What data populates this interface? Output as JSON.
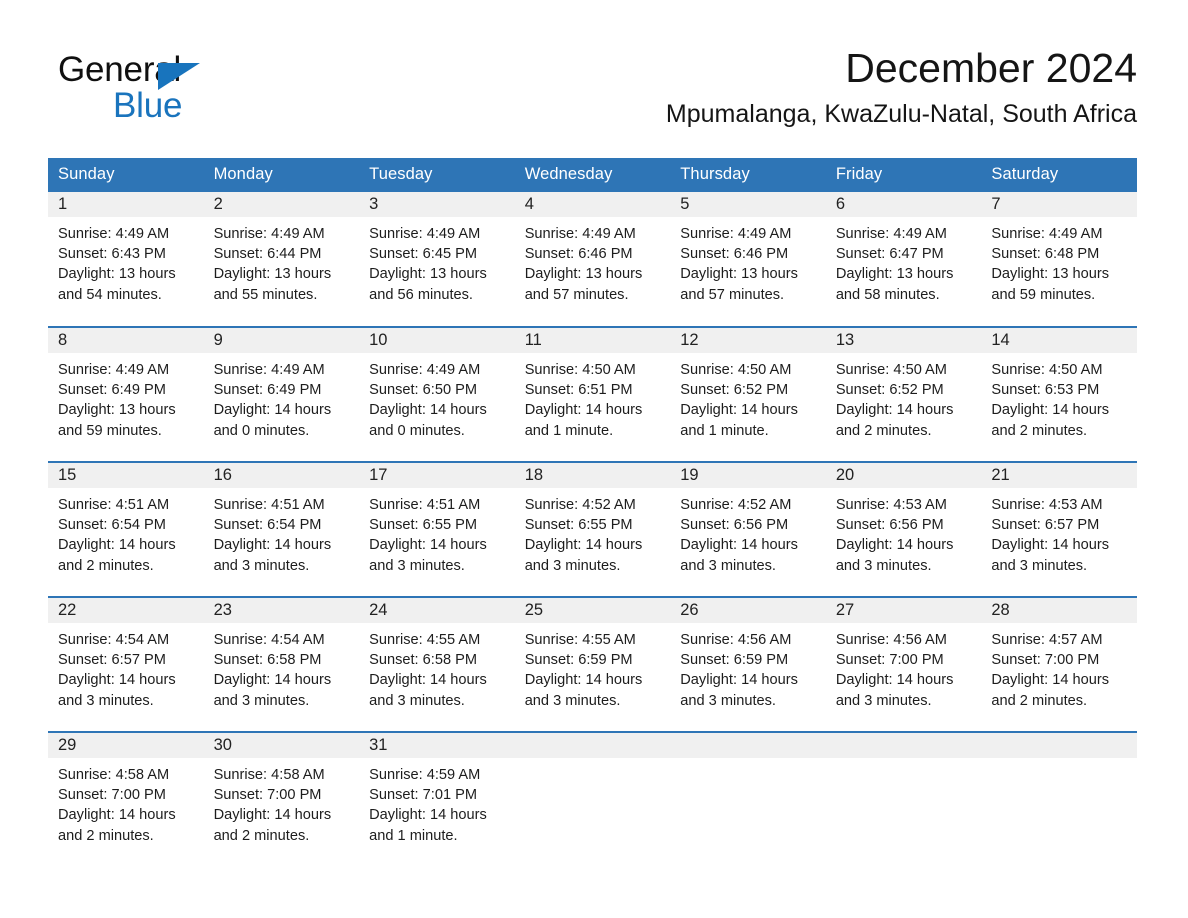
{
  "brand": {
    "name_part1": "General",
    "name_part2": "Blue",
    "accent_color": "#1a74bd"
  },
  "header": {
    "title": "December 2024",
    "subtitle": "Mpumalanga, KwaZulu-Natal, South Africa"
  },
  "theme": {
    "header_blue": "#2e75b6",
    "daynum_band": "#f0f0f0",
    "text": "#1d1d1d"
  },
  "weekday_headers": [
    "Sunday",
    "Monday",
    "Tuesday",
    "Wednesday",
    "Thursday",
    "Friday",
    "Saturday"
  ],
  "labels": {
    "sunrise_prefix": "Sunrise:",
    "sunset_prefix": "Sunset:",
    "daylight_prefix": "Daylight:"
  },
  "weeks": [
    [
      {
        "day": "1",
        "sunrise": "Sunrise: 4:49 AM",
        "sunset": "Sunset: 6:43 PM",
        "daylight": "Daylight: 13 hours and 54 minutes."
      },
      {
        "day": "2",
        "sunrise": "Sunrise: 4:49 AM",
        "sunset": "Sunset: 6:44 PM",
        "daylight": "Daylight: 13 hours and 55 minutes."
      },
      {
        "day": "3",
        "sunrise": "Sunrise: 4:49 AM",
        "sunset": "Sunset: 6:45 PM",
        "daylight": "Daylight: 13 hours and 56 minutes."
      },
      {
        "day": "4",
        "sunrise": "Sunrise: 4:49 AM",
        "sunset": "Sunset: 6:46 PM",
        "daylight": "Daylight: 13 hours and 57 minutes."
      },
      {
        "day": "5",
        "sunrise": "Sunrise: 4:49 AM",
        "sunset": "Sunset: 6:46 PM",
        "daylight": "Daylight: 13 hours and 57 minutes."
      },
      {
        "day": "6",
        "sunrise": "Sunrise: 4:49 AM",
        "sunset": "Sunset: 6:47 PM",
        "daylight": "Daylight: 13 hours and 58 minutes."
      },
      {
        "day": "7",
        "sunrise": "Sunrise: 4:49 AM",
        "sunset": "Sunset: 6:48 PM",
        "daylight": "Daylight: 13 hours and 59 minutes."
      }
    ],
    [
      {
        "day": "8",
        "sunrise": "Sunrise: 4:49 AM",
        "sunset": "Sunset: 6:49 PM",
        "daylight": "Daylight: 13 hours and 59 minutes."
      },
      {
        "day": "9",
        "sunrise": "Sunrise: 4:49 AM",
        "sunset": "Sunset: 6:49 PM",
        "daylight": "Daylight: 14 hours and 0 minutes."
      },
      {
        "day": "10",
        "sunrise": "Sunrise: 4:49 AM",
        "sunset": "Sunset: 6:50 PM",
        "daylight": "Daylight: 14 hours and 0 minutes."
      },
      {
        "day": "11",
        "sunrise": "Sunrise: 4:50 AM",
        "sunset": "Sunset: 6:51 PM",
        "daylight": "Daylight: 14 hours and 1 minute."
      },
      {
        "day": "12",
        "sunrise": "Sunrise: 4:50 AM",
        "sunset": "Sunset: 6:52 PM",
        "daylight": "Daylight: 14 hours and 1 minute."
      },
      {
        "day": "13",
        "sunrise": "Sunrise: 4:50 AM",
        "sunset": "Sunset: 6:52 PM",
        "daylight": "Daylight: 14 hours and 2 minutes."
      },
      {
        "day": "14",
        "sunrise": "Sunrise: 4:50 AM",
        "sunset": "Sunset: 6:53 PM",
        "daylight": "Daylight: 14 hours and 2 minutes."
      }
    ],
    [
      {
        "day": "15",
        "sunrise": "Sunrise: 4:51 AM",
        "sunset": "Sunset: 6:54 PM",
        "daylight": "Daylight: 14 hours and 2 minutes."
      },
      {
        "day": "16",
        "sunrise": "Sunrise: 4:51 AM",
        "sunset": "Sunset: 6:54 PM",
        "daylight": "Daylight: 14 hours and 3 minutes."
      },
      {
        "day": "17",
        "sunrise": "Sunrise: 4:51 AM",
        "sunset": "Sunset: 6:55 PM",
        "daylight": "Daylight: 14 hours and 3 minutes."
      },
      {
        "day": "18",
        "sunrise": "Sunrise: 4:52 AM",
        "sunset": "Sunset: 6:55 PM",
        "daylight": "Daylight: 14 hours and 3 minutes."
      },
      {
        "day": "19",
        "sunrise": "Sunrise: 4:52 AM",
        "sunset": "Sunset: 6:56 PM",
        "daylight": "Daylight: 14 hours and 3 minutes."
      },
      {
        "day": "20",
        "sunrise": "Sunrise: 4:53 AM",
        "sunset": "Sunset: 6:56 PM",
        "daylight": "Daylight: 14 hours and 3 minutes."
      },
      {
        "day": "21",
        "sunrise": "Sunrise: 4:53 AM",
        "sunset": "Sunset: 6:57 PM",
        "daylight": "Daylight: 14 hours and 3 minutes."
      }
    ],
    [
      {
        "day": "22",
        "sunrise": "Sunrise: 4:54 AM",
        "sunset": "Sunset: 6:57 PM",
        "daylight": "Daylight: 14 hours and 3 minutes."
      },
      {
        "day": "23",
        "sunrise": "Sunrise: 4:54 AM",
        "sunset": "Sunset: 6:58 PM",
        "daylight": "Daylight: 14 hours and 3 minutes."
      },
      {
        "day": "24",
        "sunrise": "Sunrise: 4:55 AM",
        "sunset": "Sunset: 6:58 PM",
        "daylight": "Daylight: 14 hours and 3 minutes."
      },
      {
        "day": "25",
        "sunrise": "Sunrise: 4:55 AM",
        "sunset": "Sunset: 6:59 PM",
        "daylight": "Daylight: 14 hours and 3 minutes."
      },
      {
        "day": "26",
        "sunrise": "Sunrise: 4:56 AM",
        "sunset": "Sunset: 6:59 PM",
        "daylight": "Daylight: 14 hours and 3 minutes."
      },
      {
        "day": "27",
        "sunrise": "Sunrise: 4:56 AM",
        "sunset": "Sunset: 7:00 PM",
        "daylight": "Daylight: 14 hours and 3 minutes."
      },
      {
        "day": "28",
        "sunrise": "Sunrise: 4:57 AM",
        "sunset": "Sunset: 7:00 PM",
        "daylight": "Daylight: 14 hours and 2 minutes."
      }
    ],
    [
      {
        "day": "29",
        "sunrise": "Sunrise: 4:58 AM",
        "sunset": "Sunset: 7:00 PM",
        "daylight": "Daylight: 14 hours and 2 minutes."
      },
      {
        "day": "30",
        "sunrise": "Sunrise: 4:58 AM",
        "sunset": "Sunset: 7:00 PM",
        "daylight": "Daylight: 14 hours and 2 minutes."
      },
      {
        "day": "31",
        "sunrise": "Sunrise: 4:59 AM",
        "sunset": "Sunset: 7:01 PM",
        "daylight": "Daylight: 14 hours and 1 minute."
      },
      {
        "day": "",
        "sunrise": "",
        "sunset": "",
        "daylight": ""
      },
      {
        "day": "",
        "sunrise": "",
        "sunset": "",
        "daylight": ""
      },
      {
        "day": "",
        "sunrise": "",
        "sunset": "",
        "daylight": ""
      },
      {
        "day": "",
        "sunrise": "",
        "sunset": "",
        "daylight": ""
      }
    ]
  ]
}
